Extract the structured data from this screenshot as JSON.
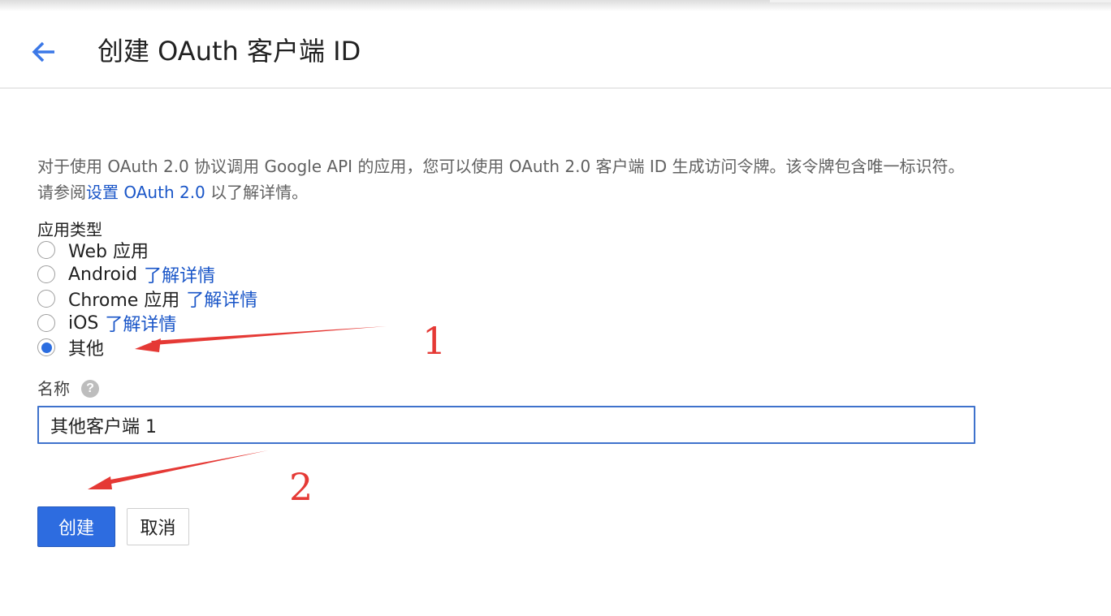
{
  "header": {
    "title": "创建 OAuth 客户端 ID"
  },
  "description": {
    "text": "对于使用 OAuth 2.0 协议调用 Google API 的应用，您可以使用 OAuth 2.0 客户端 ID 生成访问令牌。该令牌包含唯一标识符。请参阅",
    "link": "设置 OAuth 2.0",
    "suffix": " 以了解详情。"
  },
  "app_type": {
    "label": "应用类型",
    "options": [
      {
        "label": "Web 应用",
        "link": "",
        "checked": false
      },
      {
        "label": "Android",
        "link": "了解详情",
        "checked": false
      },
      {
        "label": "Chrome 应用",
        "link": "了解详情",
        "checked": false
      },
      {
        "label": "iOS",
        "link": "了解详情",
        "checked": false
      },
      {
        "label": "其他",
        "link": "",
        "checked": true
      }
    ]
  },
  "name_field": {
    "label": "名称",
    "help": "?",
    "value": "其他客户端 1"
  },
  "buttons": {
    "create": "创建",
    "cancel": "取消"
  },
  "annotations": {
    "arrow1_label": "1",
    "arrow2_label": "2",
    "color": "#e53935"
  },
  "colors": {
    "accent": "#2d6ce0",
    "link": "#1a56c8"
  }
}
